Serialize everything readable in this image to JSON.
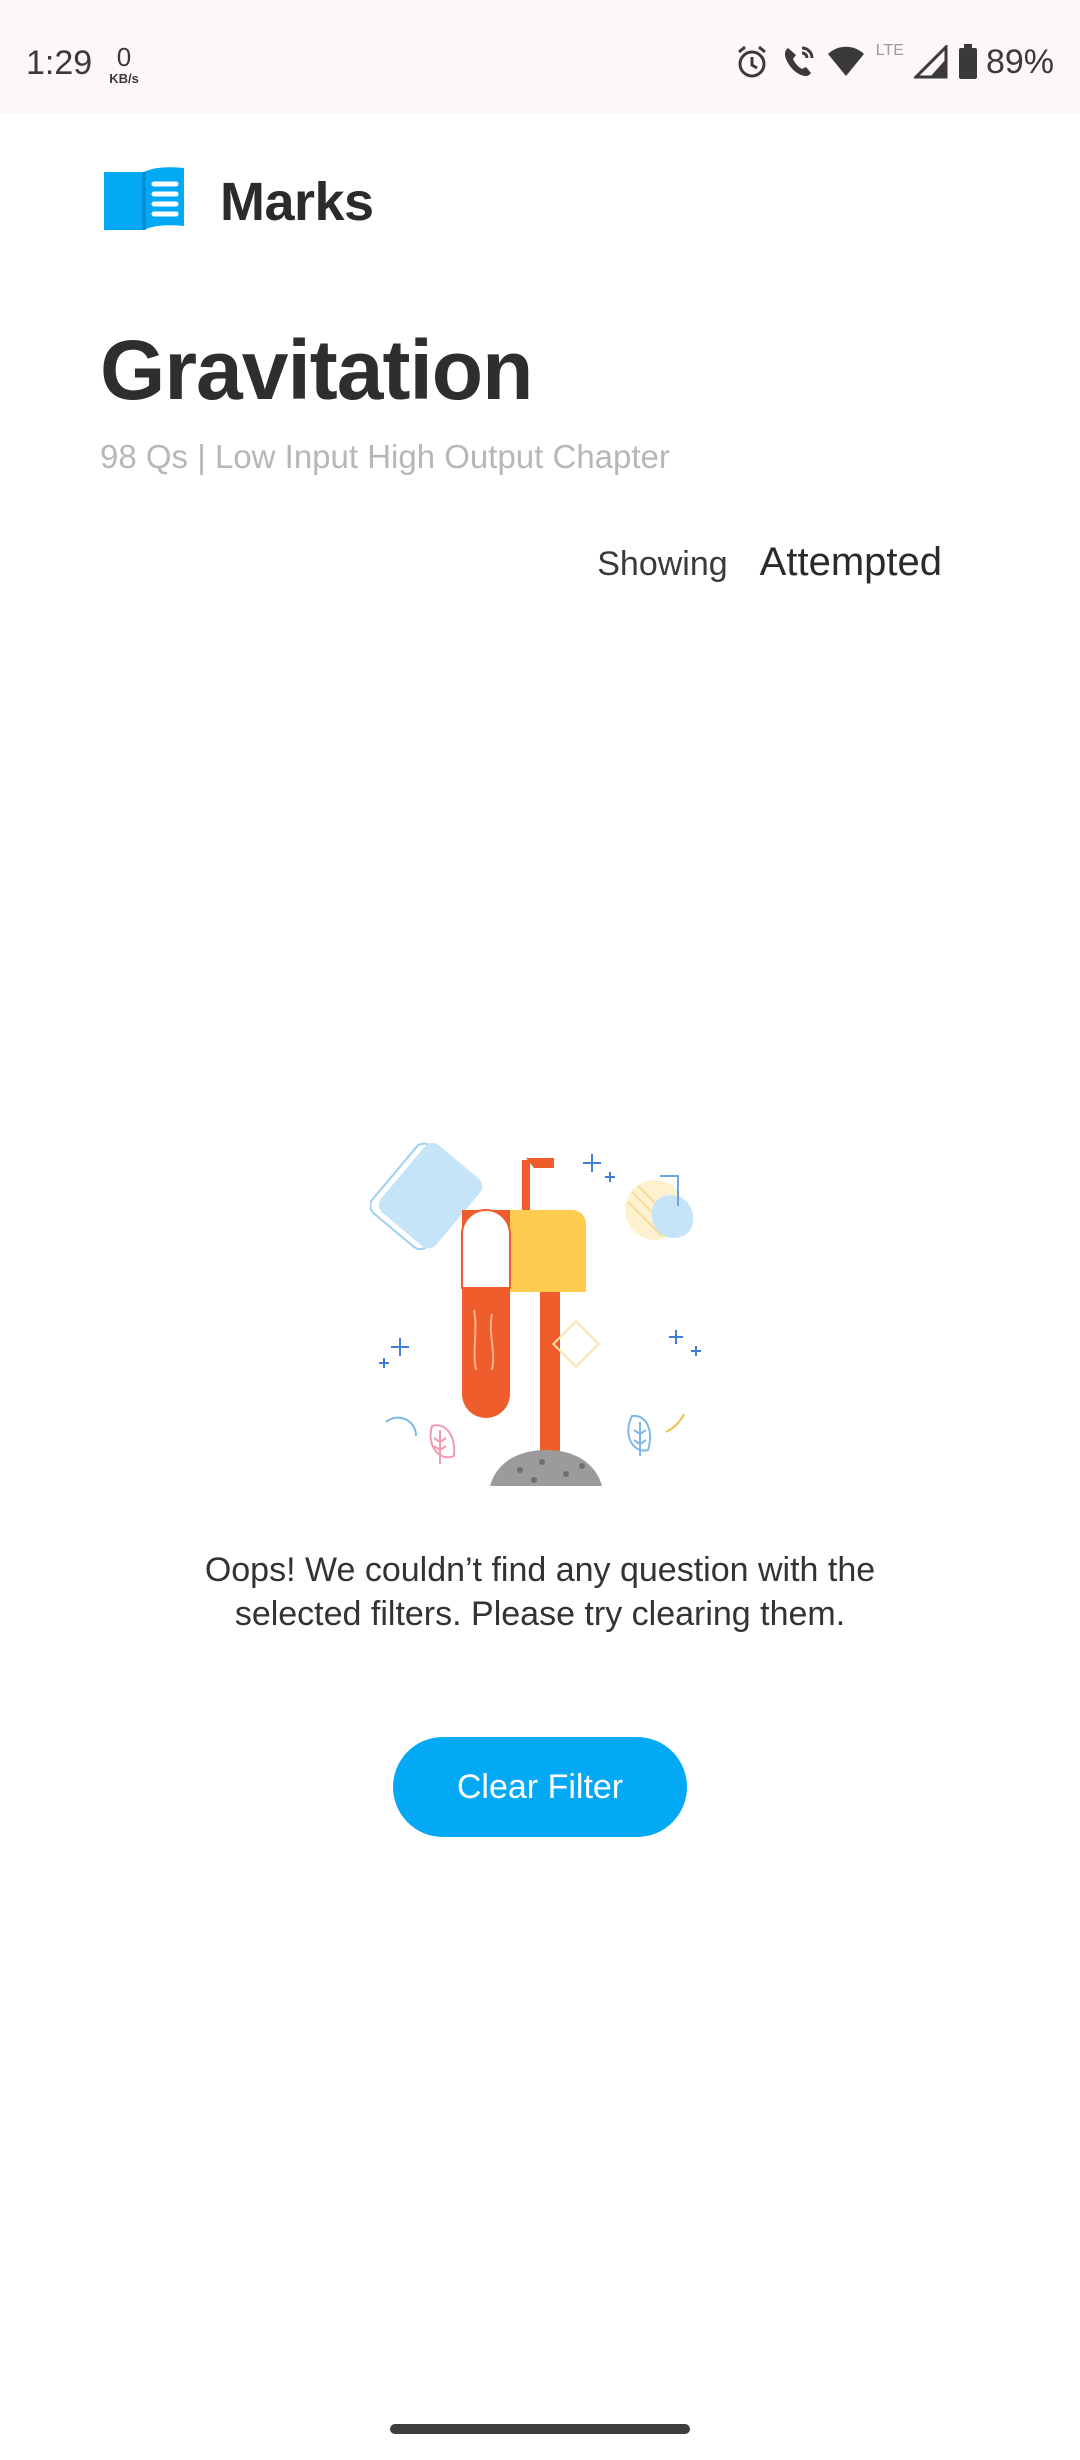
{
  "status_bar": {
    "time": "1:29",
    "speed_value": "0",
    "speed_unit": "KB/s",
    "network_label": "LTE",
    "battery_percent": "89%"
  },
  "brand": {
    "name": "Marks",
    "logo_icon": "open-book-icon",
    "logo_color": "#03a9f4"
  },
  "chapter": {
    "title": "Gravitation",
    "subtitle": "98 Qs | Low Input High Output Chapter"
  },
  "filter": {
    "label": "Showing",
    "value": "Attempted"
  },
  "empty_state": {
    "illustration": "mailbox-illustration",
    "line1": "Oops! We couldn’t find any question with the",
    "line2": "selected filters. Please try clearing them."
  },
  "actions": {
    "clear_filter_label": "Clear Filter",
    "clear_filter_color": "#03a9f4"
  }
}
